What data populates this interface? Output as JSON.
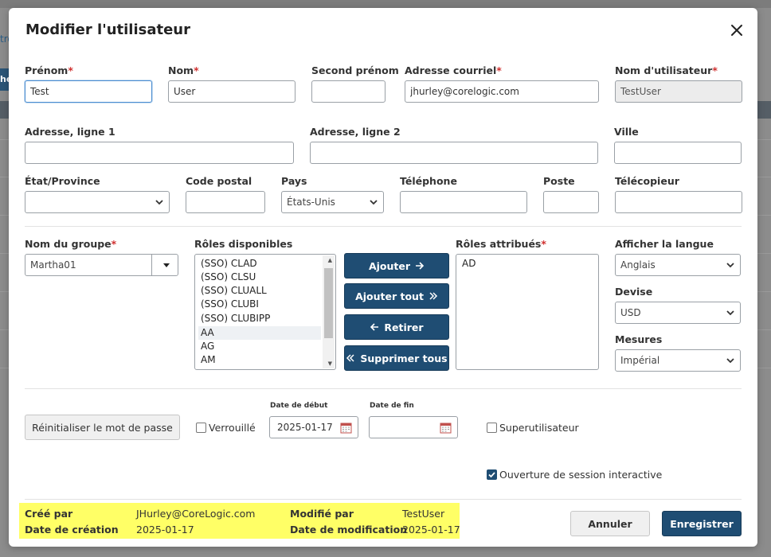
{
  "modal": {
    "title": "Modifier l'utilisateur"
  },
  "form": {
    "first_name": {
      "label": "Prénom",
      "value": "Test"
    },
    "last_name": {
      "label": "Nom",
      "value": "User"
    },
    "middle_name": {
      "label": "Second prénom",
      "value": ""
    },
    "email": {
      "label": "Adresse courriel",
      "value": "jhurley@corelogic.com"
    },
    "username": {
      "label": "Nom d'utilisateur",
      "value": "TestUser"
    },
    "address1": {
      "label": "Adresse, ligne 1",
      "value": ""
    },
    "address2": {
      "label": "Adresse, ligne 2",
      "value": ""
    },
    "city": {
      "label": "Ville",
      "value": ""
    },
    "state": {
      "label": "État/Province",
      "value": ""
    },
    "postal": {
      "label": "Code postal",
      "value": ""
    },
    "country": {
      "label": "Pays",
      "value": "États-Unis"
    },
    "phone": {
      "label": "Téléphone",
      "value": ""
    },
    "extension": {
      "label": "Poste",
      "value": ""
    },
    "fax": {
      "label": "Télécopieur",
      "value": ""
    },
    "required_marker": "*"
  },
  "roles": {
    "group_label": "Nom du groupe",
    "group_value": "Martha01",
    "available_label": "Rôles disponibles",
    "available": [
      "(SSO) CLAD",
      "(SSO) CLSU",
      "(SSO) CLUALL",
      "(SSO) CLUBI",
      "(SSO) CLUBIPP",
      "AA",
      "AG",
      "AM"
    ],
    "assigned_label": "Rôles attribués",
    "assigned": [
      "AD"
    ],
    "add": "Ajouter",
    "add_all": "Ajouter tout",
    "remove": "Retirer",
    "remove_all": "Supprimer tous"
  },
  "prefs": {
    "language_label": "Afficher la langue",
    "language_value": "Anglais",
    "currency_label": "Devise",
    "currency_value": "USD",
    "measures_label": "Mesures",
    "measures_value": "Impérial"
  },
  "account": {
    "reset_password": "Réinitialiser le mot de passe",
    "locked_label": "Verrouillé",
    "start_date_label": "Date de début",
    "start_date_value": "2025-01-17",
    "end_date_label": "Date de fin",
    "end_date_value": "",
    "superuser_label": "Superutilisateur",
    "interactive_label": "Ouverture de session interactive"
  },
  "audit": {
    "created_by_label": "Créé par",
    "created_by_value": "JHurley@CoreLogic.com",
    "created_date_label": "Date de création",
    "created_date_value": "2025-01-17",
    "modified_by_label": "Modifié par",
    "modified_by_value": "TestUser",
    "modified_date_label": "Date de modification",
    "modified_date_value": "2025-01-17"
  },
  "footer": {
    "cancel": "Annuler",
    "save": "Enregistrer"
  },
  "colors": {
    "primary": "#1f4d73",
    "required": "#d0302f",
    "highlight": "#ffff66"
  }
}
